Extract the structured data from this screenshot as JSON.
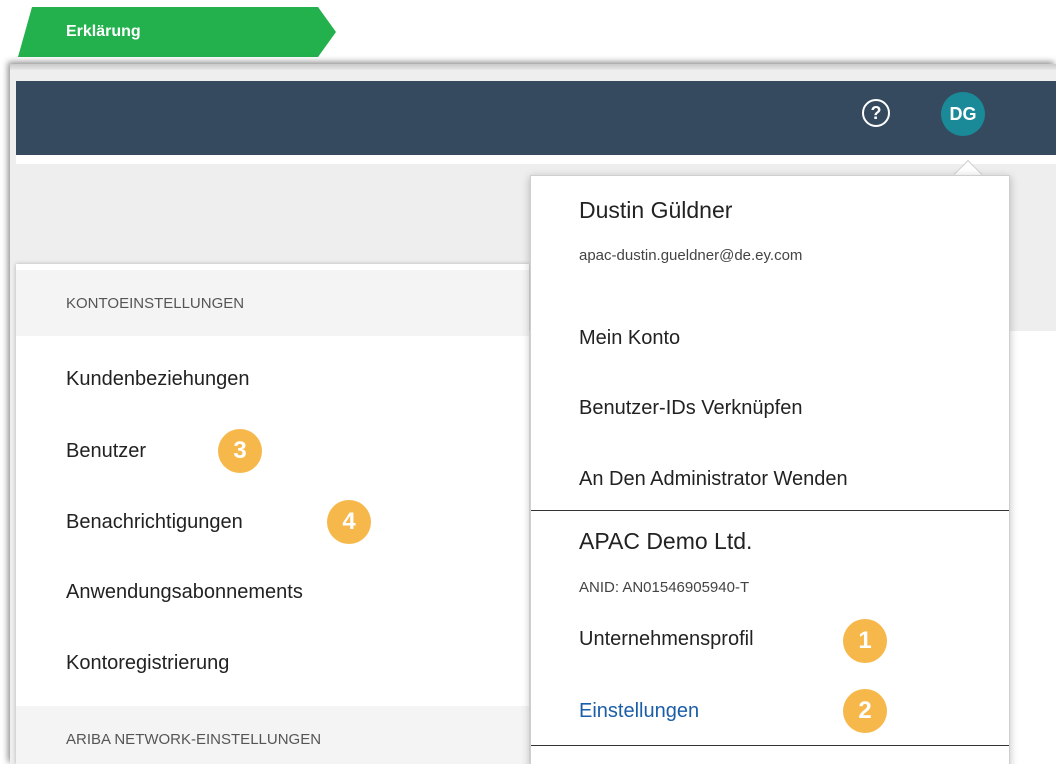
{
  "tag": {
    "label": "Erklärung"
  },
  "topbar": {
    "help_icon": "?",
    "avatar_initials": "DG"
  },
  "left_menu": {
    "section1_header": "KONTOEINSTELLUNGEN",
    "items": [
      "Kundenbeziehungen",
      "Benutzer",
      "Benachrichtigungen",
      "Anwendungsabonnements",
      "Kontoregistrierung"
    ],
    "section2_header": "ARIBA NETWORK-EINSTELLUNGEN"
  },
  "user_menu": {
    "name": "Dustin Güldner",
    "email": "apac-dustin.gueldner@de.ey.com",
    "items": [
      "Mein Konto",
      "Benutzer-IDs Verknüpfen",
      "An Den Administrator Wenden"
    ],
    "company_name": "APAC Demo Ltd.",
    "anid": "ANID: AN01546905940-T",
    "company_profile": "Unternehmensprofil",
    "settings": "Einstellungen"
  },
  "badges": [
    "1",
    "2",
    "3",
    "4"
  ],
  "colors": {
    "topbar": "#354a5f",
    "avatar": "#1a8a99",
    "badge": "#f6b84b",
    "tag": "#23b14d",
    "link": "#1b5ea8"
  }
}
